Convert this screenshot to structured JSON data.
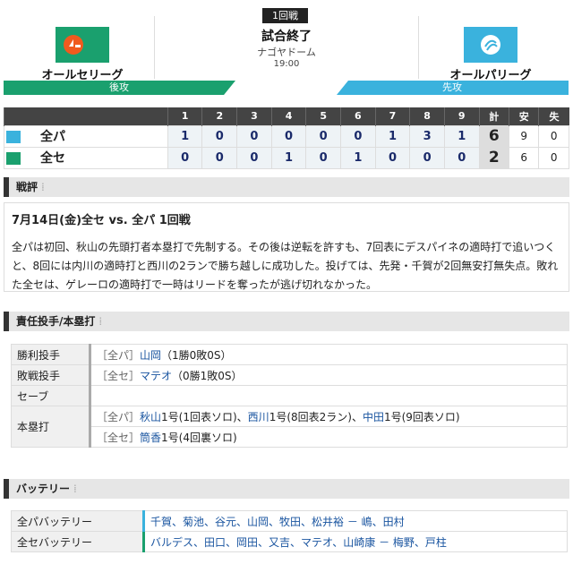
{
  "header": {
    "game_badge": "1回戦",
    "status": "試合終了",
    "venue": "ナゴヤドーム",
    "time": "19:00",
    "home_team": "オールセリーグ",
    "away_team": "オールパリーグ",
    "home_side": "後攻",
    "away_side": "先攻",
    "home_color": "#1aa06e",
    "away_color": "#3ab2dd"
  },
  "scoreboard": {
    "innings": [
      "1",
      "2",
      "3",
      "4",
      "5",
      "6",
      "7",
      "8",
      "9"
    ],
    "total_label": "計",
    "hits_label": "安",
    "errors_label": "失",
    "rows": [
      {
        "team": "全パ",
        "scores": [
          "1",
          "0",
          "0",
          "0",
          "0",
          "0",
          "1",
          "3",
          "1"
        ],
        "total": "6",
        "hits": "9",
        "errors": "0"
      },
      {
        "team": "全セ",
        "scores": [
          "0",
          "0",
          "0",
          "1",
          "0",
          "1",
          "0",
          "0",
          "0"
        ],
        "total": "2",
        "hits": "6",
        "errors": "0"
      }
    ]
  },
  "review": {
    "section": "戦評",
    "title": "7月14日(金)全セ vs. 全パ 1回戦",
    "body": "全パは初回、秋山の先頭打者本塁打で先制する。その後は逆転を許すも、7回表にデスパイネの適時打で追いつくと、8回には内川の適時打と西川の2ランで勝ち越しに成功した。投げては、先発・千賀が2回無安打無失点。敗れた全セは、ゲレーロの適時打で一時はリードを奪ったが逃げ切れなかった。"
  },
  "pitchers": {
    "section": "責任投手/本塁打",
    "win_label": "勝利投手",
    "win_team": "［全パ］",
    "win_name": "山岡",
    "win_rec": "（1勝0敗0S）",
    "loss_label": "敗戦投手",
    "loss_team": "［全セ］",
    "loss_name": "マテオ",
    "loss_rec": "（0勝1敗0S）",
    "save_label": "セーブ",
    "hr_label": "本塁打",
    "hr_pl_team": "［全パ］",
    "hr_pl_1": "秋山",
    "hr_pl_1d": "1号(1回表ソロ)、",
    "hr_pl_2": "西川",
    "hr_pl_2d": "1号(8回表2ラン)、",
    "hr_pl_3": "中田",
    "hr_pl_3d": "1号(9回表ソロ)",
    "hr_cl_team": "［全セ］",
    "hr_cl_1": "筒香",
    "hr_cl_1d": "1号(4回裏ソロ)"
  },
  "battery": {
    "section": "バッテリー",
    "pl_label": "全パバッテリー",
    "pl_value": "千賀、菊池、谷元、山岡、牧田、松井裕 － 嶋、田村",
    "cl_label": "全セバッテリー",
    "cl_value": "バルデス、田口、岡田、又吉、マテオ、山崎康 － 梅野、戸柱"
  }
}
